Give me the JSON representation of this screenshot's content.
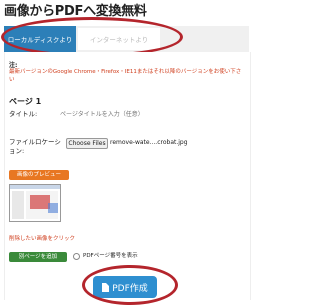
{
  "header": {
    "title": "画像からPDFへ変換無料"
  },
  "tabs": {
    "active": "ローカルディスクより",
    "inactive": "インターネットより"
  },
  "notice": {
    "label": "注:",
    "text": "最新バージョンのGoogle Chrome・Firefox・IE11またはそれ以降のバージョンをお使い下さい"
  },
  "form": {
    "page_heading": "ページ 1",
    "title_label": "タイトル:",
    "title_placeholder": "ページタイトルを入力（任意）",
    "file_label": "ファイルロケーション:",
    "choose_button": "Choose Files",
    "file_name": "remove-wate....crobat.jpg",
    "preview_button": "画像のプレビュー",
    "delete_link": "削除したい画像をクリック",
    "add_page_button": "別ページを追加",
    "page_number_label": "PDFページ番号を表示"
  },
  "actions": {
    "create_button": "PDF作成"
  },
  "colors": {
    "tab_active_bg": "#2c7fb8",
    "highlight_ring": "#b4252c",
    "preview_btn": "#e87722",
    "add_btn": "#3a8a3a",
    "create_btn": "#2e8fd0",
    "notice_text": "#d04020"
  }
}
